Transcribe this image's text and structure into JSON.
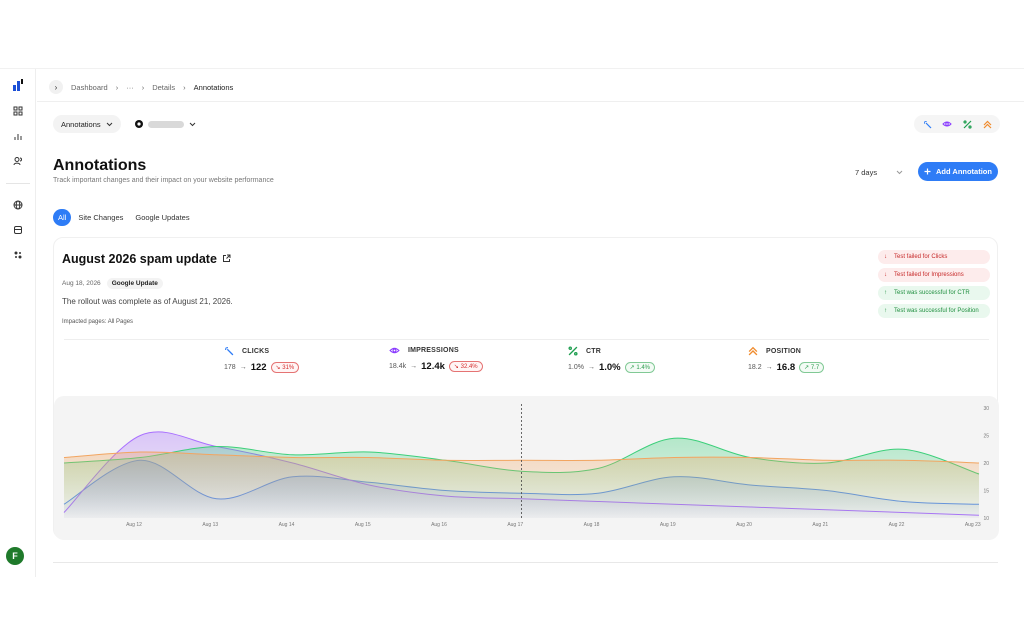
{
  "breadcrumb": {
    "items": [
      "Dashboard",
      "···",
      "Details"
    ],
    "current": "Annotations",
    "sep": "›"
  },
  "toolbar": {
    "page_select": "Annotations",
    "site_select": ""
  },
  "header": {
    "title": "Annotations",
    "subtitle": "Track important changes and their impact on your website performance",
    "range_label": "7 days",
    "add_label": "Add Annotation"
  },
  "tabs": [
    "All",
    "Site Changes",
    "Google Updates"
  ],
  "annotation": {
    "title": "August 2026 spam update",
    "date": "Aug 18, 2026",
    "badge": "Google Update",
    "description": "The rollout was complete as of August 21, 2026.",
    "pages": "Impacted pages: All Pages"
  },
  "tests": [
    {
      "label": "Test failed for Clicks",
      "status": "fail"
    },
    {
      "label": "Test failed for Impressions",
      "status": "fail"
    },
    {
      "label": "Test was successful for CTR",
      "status": "pass"
    },
    {
      "label": "Test was successful for Position",
      "status": "pass"
    }
  ],
  "metrics": [
    {
      "name": "CLICKS",
      "from": "178",
      "to": "122",
      "change": "31%",
      "dir": "down",
      "color": "#2e7cf6"
    },
    {
      "name": "IMPRESSIONS",
      "from": "18.4k",
      "to": "12.4k",
      "change": "32.4%",
      "dir": "down",
      "color": "#8b3dff"
    },
    {
      "name": "CTR",
      "from": "1.0%",
      "to": "1.0%",
      "change": "1.4%",
      "dir": "up",
      "color": "#1e9e4f"
    },
    {
      "name": "POSITION",
      "from": "18.2",
      "to": "16.8",
      "change": "7.7",
      "dir": "up",
      "color": "#f08c2e"
    }
  ],
  "avatar_letter": "F",
  "arrow": "→",
  "chart_data": {
    "type": "area",
    "x": [
      "Aug 12",
      "Aug 13",
      "Aug 14",
      "Aug 15",
      "Aug 16",
      "Aug 17",
      "Aug 18",
      "Aug 19",
      "Aug 20",
      "Aug 21",
      "Aug 22",
      "Aug 23",
      "Aug 24"
    ],
    "y_ticks": [
      "30",
      "25",
      "20",
      "15",
      "10"
    ],
    "ylim": [
      10,
      30
    ],
    "annotation_marker": "Aug 18",
    "series": [
      {
        "color": "#5b8def",
        "values": [
          12.5,
          20.5,
          13.5,
          17.5,
          16.5,
          15,
          14.5,
          14.5,
          17.5,
          16,
          15,
          13,
          12.5
        ]
      },
      {
        "color": "#a970ff",
        "values": [
          11,
          25,
          23,
          20,
          16,
          14,
          13.5,
          13,
          12.5,
          12,
          11.5,
          11,
          10.5
        ]
      },
      {
        "color": "#3ccf7a",
        "values": [
          20,
          21,
          23,
          21.5,
          22,
          20.5,
          18.5,
          19,
          24.5,
          21,
          20,
          22.5,
          18
        ]
      },
      {
        "color": "#f2a560",
        "values": [
          21,
          22,
          21.5,
          21,
          21,
          20.5,
          20.5,
          20.5,
          21,
          21,
          20.5,
          20.5,
          20
        ]
      }
    ]
  }
}
